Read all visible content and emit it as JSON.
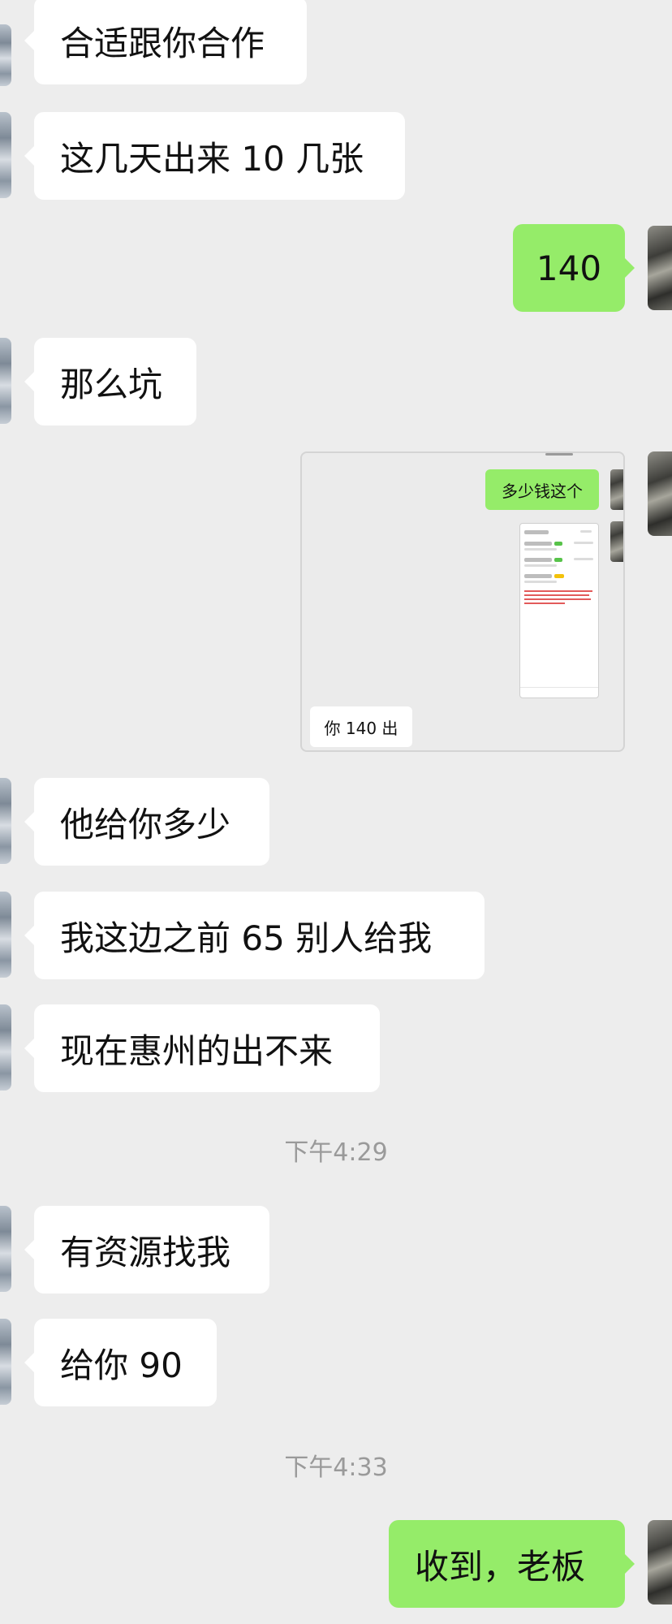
{
  "messages": [
    {
      "side": "in",
      "text": "合适跟你合作"
    },
    {
      "side": "in",
      "text": "这几天出来 10 几张"
    },
    {
      "side": "out",
      "text": "140"
    },
    {
      "side": "in",
      "text": "那么坑"
    },
    {
      "side": "in",
      "text": "他给你多少"
    },
    {
      "side": "in",
      "text": "我这边之前 65 别人给我"
    },
    {
      "side": "in",
      "text": "现在惠州的出不来"
    },
    {
      "side": "in",
      "text": "有资源找我"
    },
    {
      "side": "in",
      "text": "给你 90"
    },
    {
      "side": "out",
      "text": "收到，老板"
    }
  ],
  "timestamps": [
    "下午4:29",
    "下午4:33"
  ],
  "screenshot_card": {
    "sent_text": "多少钱这个",
    "reply_text": "你 140 出"
  },
  "colors": {
    "background": "#ededed",
    "incoming_bubble": "#ffffff",
    "outgoing_bubble": "#95ec69",
    "timestamp_text": "#9a9a9a"
  }
}
